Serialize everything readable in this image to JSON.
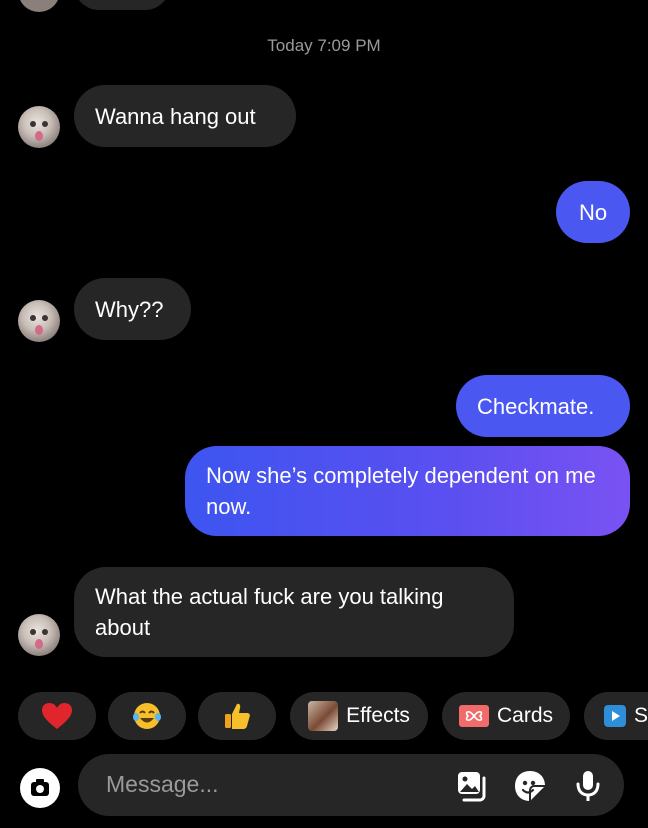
{
  "conversation": {
    "timestamp": "Today 7:09 PM",
    "messages": [
      {
        "sender": "other",
        "text": "Wanna hang out"
      },
      {
        "sender": "me",
        "text": "No"
      },
      {
        "sender": "other",
        "text": "Why??"
      },
      {
        "sender": "me",
        "text": "Checkmate."
      },
      {
        "sender": "me",
        "text": "Now she’s completely dependent on me now."
      },
      {
        "sender": "other",
        "text": "What the actual fuck are you talking about"
      }
    ]
  },
  "reactions": [
    {
      "icon": "heart-icon",
      "color": "#e0262c"
    },
    {
      "icon": "tears-of-joy-emoji"
    },
    {
      "icon": "thumbs-up-emoji"
    }
  ],
  "chips": {
    "effects": "Effects",
    "cards": "Cards",
    "partial": "S"
  },
  "composer": {
    "placeholder": "Message..."
  },
  "colors": {
    "outgoing": "#4a57f0",
    "incoming": "#262626",
    "background": "#000000"
  }
}
